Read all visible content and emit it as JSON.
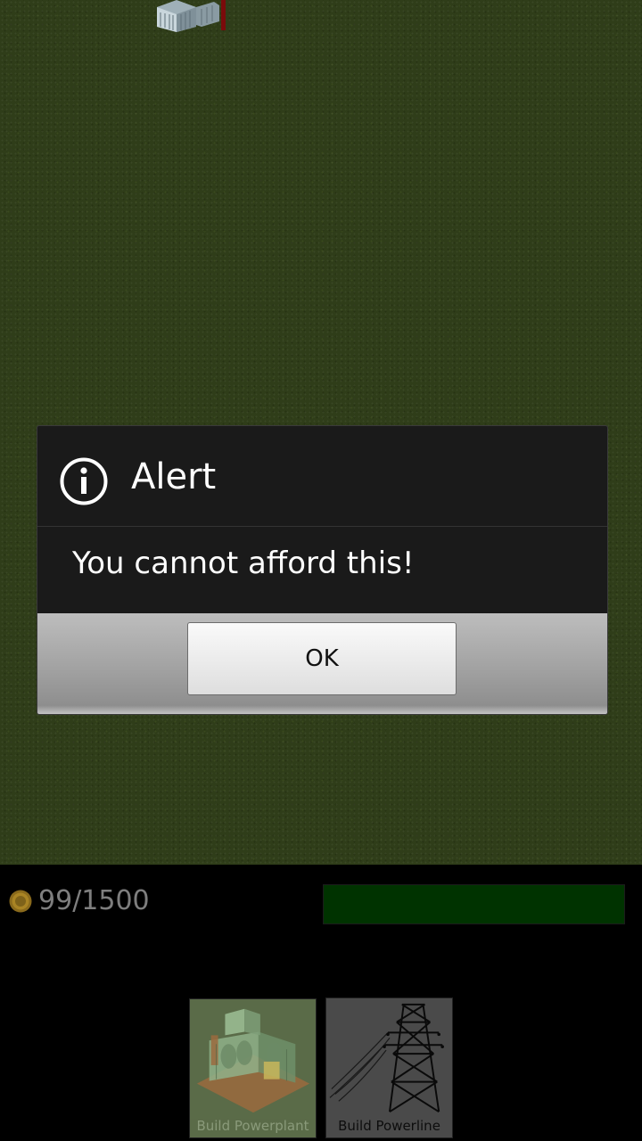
{
  "dialog": {
    "title": "Alert",
    "message": "You cannot afford this!",
    "ok_label": "OK"
  },
  "hud": {
    "money_current": "99",
    "money_separator": "/",
    "money_max": "1500",
    "power_fill": 1.0,
    "power_color": "#003300"
  },
  "build_menu": {
    "items": [
      {
        "label": "Build Powerplant",
        "icon": "powerplant-icon",
        "enabled": false
      },
      {
        "label": "Build Powerline",
        "icon": "powerline-tower-icon",
        "enabled": true
      }
    ]
  },
  "colors": {
    "grass": "#2f3d19",
    "dialog_bg": "#1a1a1a",
    "money_text": "#7e7e7e"
  }
}
